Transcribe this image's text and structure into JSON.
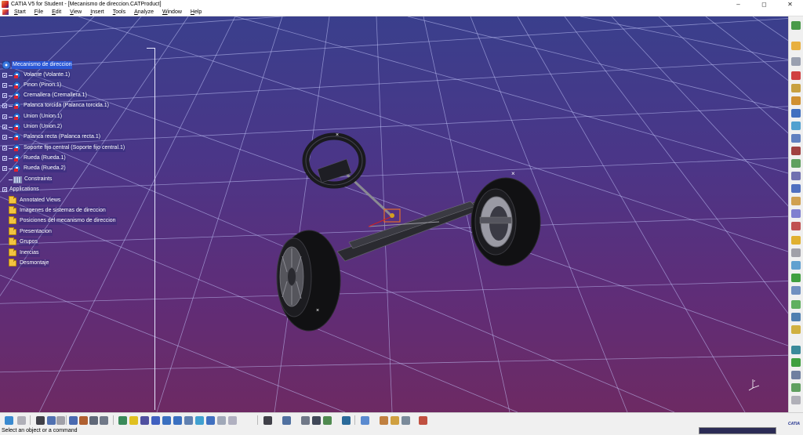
{
  "window": {
    "title": "CATIA V5 for Student - [Mecanismo de direccion.CATProduct]",
    "minimize_icon": "minimize-icon",
    "maximize_icon": "maximize-icon",
    "close_icon": "close-icon"
  },
  "menu": {
    "items": [
      "Start",
      "File",
      "Edit",
      "View",
      "Insert",
      "Tools",
      "Analyze",
      "Window",
      "Help"
    ]
  },
  "tree": {
    "root": "Mecanismo de direccion",
    "parts": [
      "Volante (Volante.1)",
      "Pinon (Pinon.1)",
      "Cremallera (Cremallera.1)",
      "Palanca torcida (Palanca torcida.1)",
      "Union (Union.1)",
      "Union (Union.2)",
      "Palanca recta (Palanca recta.1)",
      "Soporte fijo central (Soporte fijo central.1)",
      "Rueda (Rueda.1)",
      "Rueda (Rueda.2)"
    ],
    "constraints": "Constraints",
    "applications": "Applications",
    "app_folders": [
      "Annotated Views",
      "Imagenes de sistemas de direccion",
      "Posiciones del mecanismo de direccion",
      "Presentacion",
      "Grupos",
      "Inercias",
      "Desmontaje"
    ]
  },
  "status": {
    "prompt": "Select an object or a command",
    "command_value": ""
  },
  "logo": "CATIA",
  "colors": {
    "viewport_top": "#3a3f8c",
    "viewport_bottom": "#6d2a63",
    "selection": "#2a57d6",
    "grid_line": "#c8ccff"
  }
}
